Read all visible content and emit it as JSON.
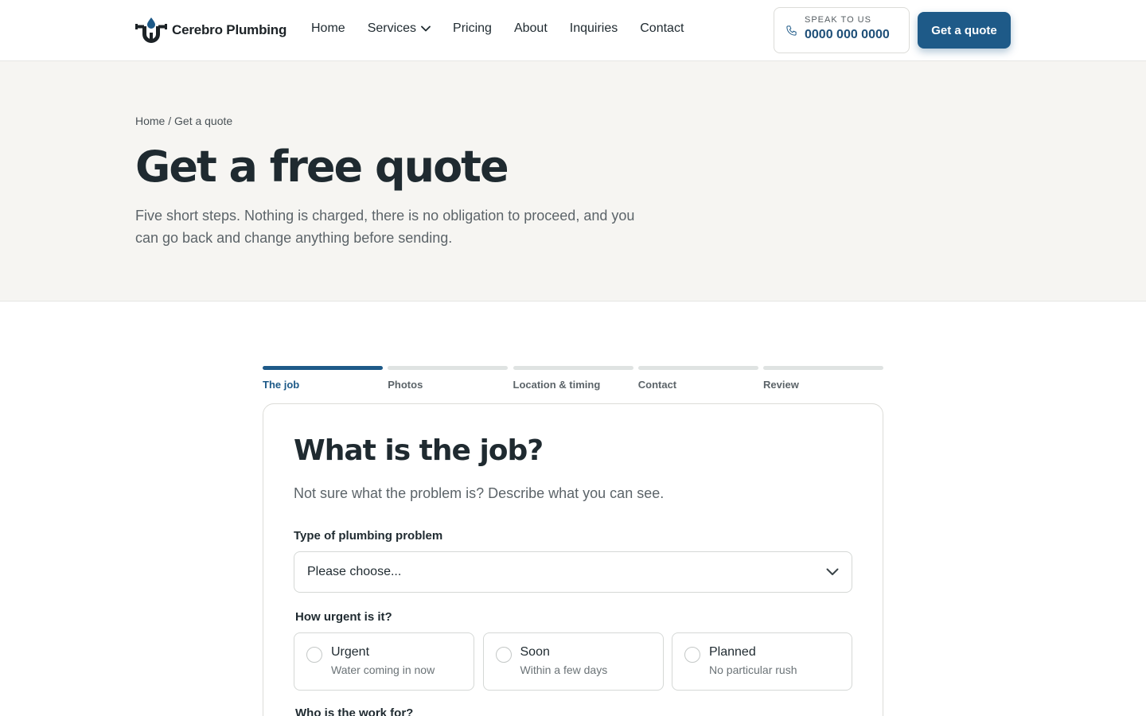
{
  "header": {
    "brand": "Cerebro Plumbing",
    "nav": [
      {
        "label": "Home"
      },
      {
        "label": "Services",
        "has_dropdown": true
      },
      {
        "label": "Pricing"
      },
      {
        "label": "About"
      },
      {
        "label": "Inquiries"
      },
      {
        "label": "Contact"
      }
    ],
    "phone_caption": "SPEAK TO US",
    "phone_number": "0000 000 0000",
    "cta_label": "Get a quote"
  },
  "hero": {
    "breadcrumb": "Home / Get a quote",
    "title": "Get a free quote",
    "subtitle": "Five short steps. Nothing is charged, there is no obligation to proceed, and you can go back and change anything before sending."
  },
  "steps": [
    {
      "label": "The job",
      "active": true
    },
    {
      "label": "Photos",
      "active": false
    },
    {
      "label": "Location & timing",
      "active": false
    },
    {
      "label": "Contact",
      "active": false
    },
    {
      "label": "Review",
      "active": false
    }
  ],
  "form": {
    "title": "What is the job?",
    "subtitle": "Not sure what the problem is? Describe what you can see.",
    "problem_label": "Type of plumbing problem",
    "problem_value": "Please choose...",
    "urgency_label": "How urgent is it?",
    "urgency_options": [
      {
        "title": "Urgent",
        "desc": "Water coming in now"
      },
      {
        "title": "Soon",
        "desc": "Within a few days"
      },
      {
        "title": "Planned",
        "desc": "No particular rush"
      }
    ],
    "who_label": "Who is the work for?"
  },
  "colors": {
    "accent": "#1e5a88",
    "hero_bg": "#f6f5f2",
    "text": "#1f2a30"
  },
  "icons": {
    "logo": "pipe-droplet-logo",
    "phone": "phone-icon",
    "dropdown": "chevron-down-icon"
  }
}
